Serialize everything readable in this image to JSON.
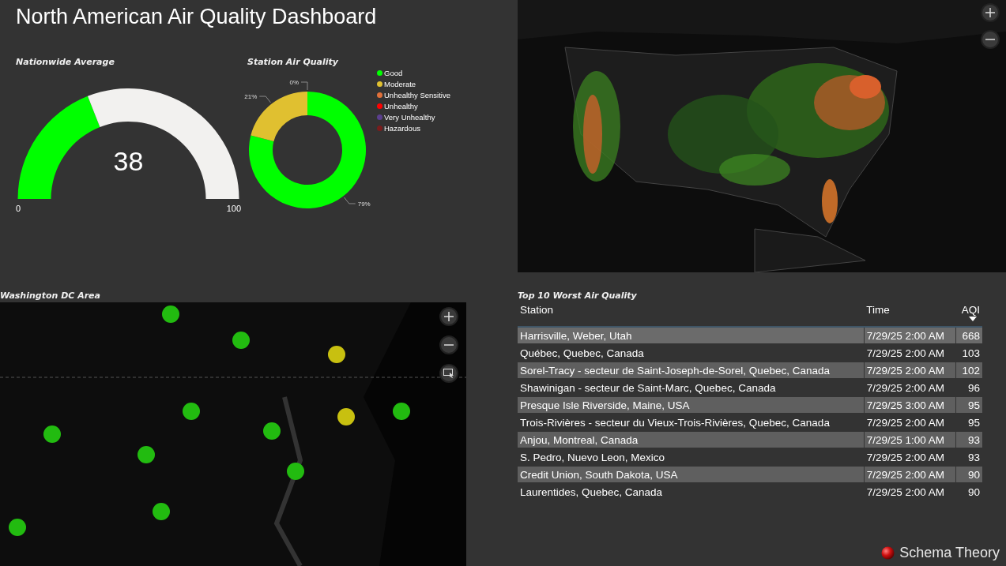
{
  "title": "North American Air Quality Dashboard",
  "nationwide_average": {
    "heading": "Nationwide Average",
    "value": "38",
    "level": 0.38,
    "min": "0",
    "max": "100"
  },
  "station_air_quality": {
    "heading": "Station Air Quality",
    "legend": [
      {
        "color": "#00ff00"
      },
      {
        "color": "#e0c030"
      },
      {
        "color": "#e0703a"
      },
      {
        "color": "#ff0000"
      },
      {
        "color": "#5b3f8f"
      },
      {
        "color": "#7a1c1c"
      }
    ],
    "chart_data": {
      "type": "donut",
      "categories": [
        "Good",
        "Moderate",
        "Unhealthy Sensitive",
        "Unhealthy",
        "Very Unhealthy",
        "Hazardous"
      ],
      "values": [
        79,
        21,
        0,
        0,
        0,
        0
      ],
      "value_labels": [
        "79%",
        "21%",
        "0%",
        null,
        null,
        null
      ]
    }
  },
  "dc_area": {
    "heading": "Washington DC Area"
  },
  "worst_table": {
    "heading": "Top 10 Worst Air Quality",
    "columns": [
      {
        "label": "Station",
        "sorted": false
      },
      {
        "label": "Time",
        "sorted": false
      },
      {
        "label": "AQI",
        "sorted": true
      }
    ],
    "rows": [
      [
        "Harrisville, Weber, Utah",
        "7/29/25 2:00 AM",
        "668"
      ],
      [
        "Québec, Quebec, Canada",
        "7/29/25 2:00 AM",
        "103"
      ],
      [
        "Sorel-Tracy - secteur de Saint-Joseph-de-Sorel, Quebec, Canada",
        "7/29/25 2:00 AM",
        "102"
      ],
      [
        "Shawinigan - secteur de Saint-Marc, Quebec, Canada",
        "7/29/25 2:00 AM",
        "96"
      ],
      [
        "Presque Isle Riverside, Maine, USA",
        "7/29/25 3:00 AM",
        "95"
      ],
      [
        "Trois-Rivières - secteur du Vieux-Trois-Rivières, Quebec, Canada",
        "7/29/25 2:00 AM",
        "95"
      ],
      [
        "Anjou, Montreal, Canada",
        "7/29/25 1:00 AM",
        "93"
      ],
      [
        "S. Pedro, Nuevo Leon, Mexico",
        "7/29/25 2:00 AM",
        "93"
      ],
      [
        "Credit Union, South Dakota, USA",
        "7/29/25 2:00 AM",
        "90"
      ],
      [
        "Laurentides, Quebec, Canada",
        "7/29/25 2:00 AM",
        "90"
      ]
    ]
  },
  "brand": "Schema Theory"
}
